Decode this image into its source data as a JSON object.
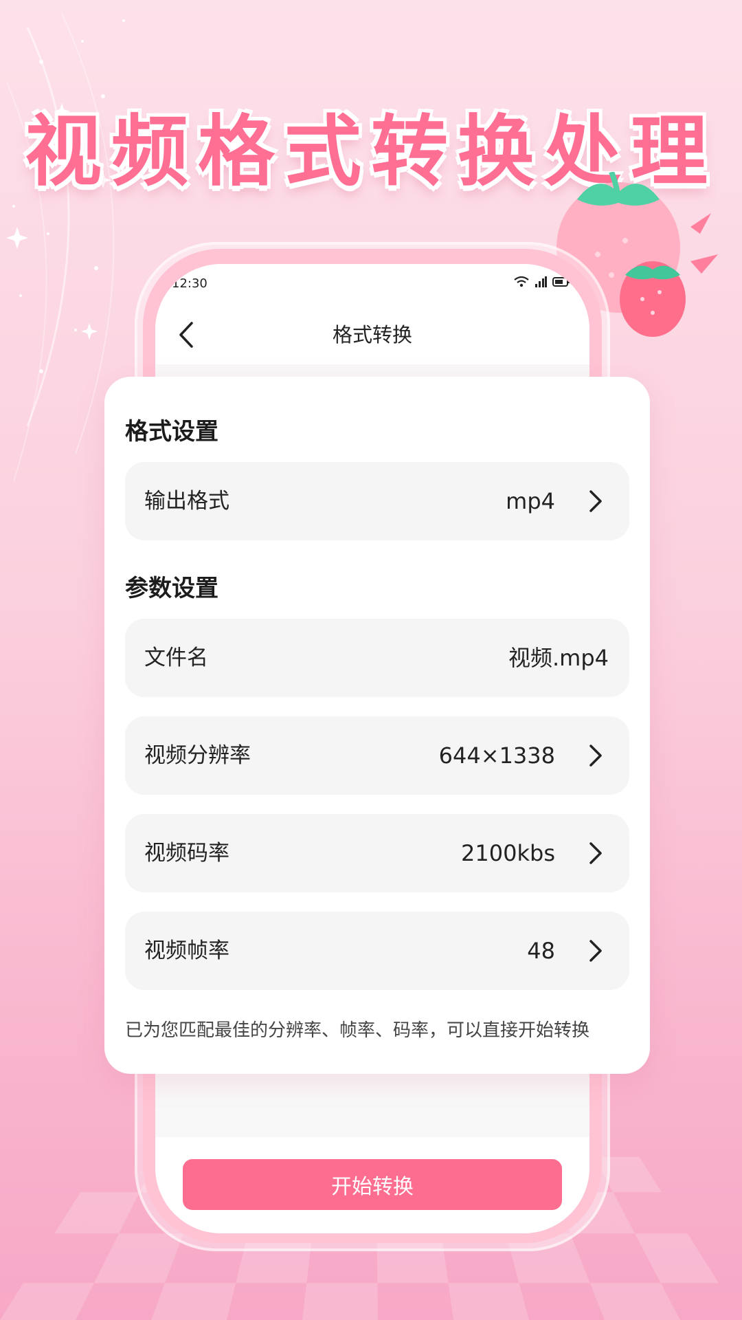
{
  "colors": {
    "accent": "#fd6d8f",
    "headline": "#ff6f94",
    "row_bg": "#f5f5f5",
    "card_bg": "#ffffff"
  },
  "headline": "视频格式转换处理",
  "status_bar": {
    "time": "12:30",
    "icons": [
      "wifi-icon",
      "signal-icon",
      "battery-icon"
    ]
  },
  "nav": {
    "back_icon": "chevron-left-icon",
    "title": "格式转换"
  },
  "format_section": {
    "title": "格式设置",
    "rows": [
      {
        "label": "输出格式",
        "value": "mp4",
        "chevron": true
      }
    ]
  },
  "params_section": {
    "title": "参数设置",
    "rows": [
      {
        "label": "文件名",
        "value": "视频.mp4",
        "chevron": false
      },
      {
        "label": "视频分辨率",
        "value": "644×1338",
        "chevron": true
      },
      {
        "label": "视频码率",
        "value": "2100kbs",
        "chevron": true
      },
      {
        "label": "视频帧率",
        "value": "48",
        "chevron": true
      }
    ]
  },
  "hint": "已为您匹配最佳的分辨率、帧率、码率，可以直接开始转换",
  "start_button": "开始转换"
}
